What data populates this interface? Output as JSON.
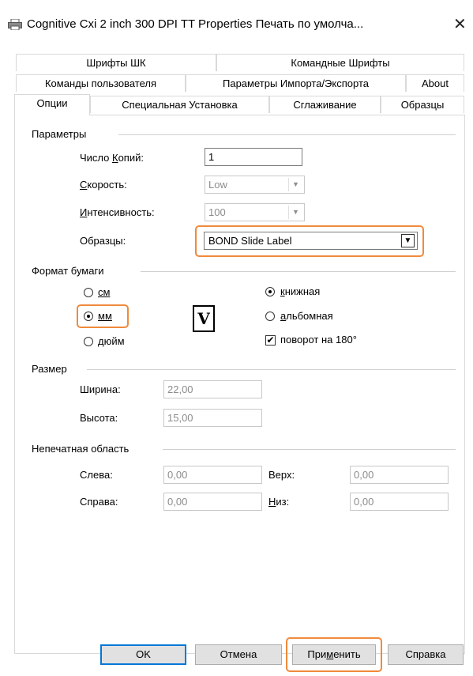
{
  "window": {
    "title": "Cognitive Cxi 2 inch 300 DPI TT Properties Печать по умолча...",
    "close_glyph": "✕"
  },
  "tabs": {
    "row1": [
      "Шрифты ШК",
      "Командные Шрифты"
    ],
    "row2": [
      "Команды пользователя",
      "Параметры Импорта/Экспорта",
      "About"
    ],
    "row3": [
      "Опции",
      "Специальная Установка",
      "Сглаживание",
      "Образцы"
    ],
    "active": "Опции"
  },
  "params": {
    "title": "Параметры",
    "copies_label": "Число Копий:",
    "copies_value": "1",
    "speed_label": "Скорость:",
    "speed_value": "Low",
    "intensity_label": "Интенсивность:",
    "intensity_value": "100",
    "samples_label": "Образцы:",
    "samples_value": "BOND Slide Label"
  },
  "paper": {
    "title": "Формат бумаги",
    "units": [
      "см",
      "мм",
      "дюйм"
    ],
    "unit_selected": "мм",
    "preview_glyph": "V",
    "orientation": [
      "книжная",
      "альбомная"
    ],
    "orientation_selected": "книжная",
    "rotate_label": "поворот на 180°",
    "rotate_checked": true
  },
  "size": {
    "title": "Размер",
    "width_label": "Ширина:",
    "width_value": "22,00",
    "height_label": "Высота:",
    "height_value": "15,00"
  },
  "nonprint": {
    "title": "Непечатная область",
    "left_label": "Слева:",
    "left_value": "0,00",
    "top_label": "Верх:",
    "top_value": "0,00",
    "right_label": "Справа:",
    "right_value": "0,00",
    "bottom_label": "Низ:",
    "bottom_value": "0,00"
  },
  "buttons": {
    "ok": "OK",
    "cancel": "Отмена",
    "apply": "Применить",
    "help": "Справка"
  },
  "colors": {
    "highlight": "#f08a3c",
    "default_button": "#0078d7"
  }
}
